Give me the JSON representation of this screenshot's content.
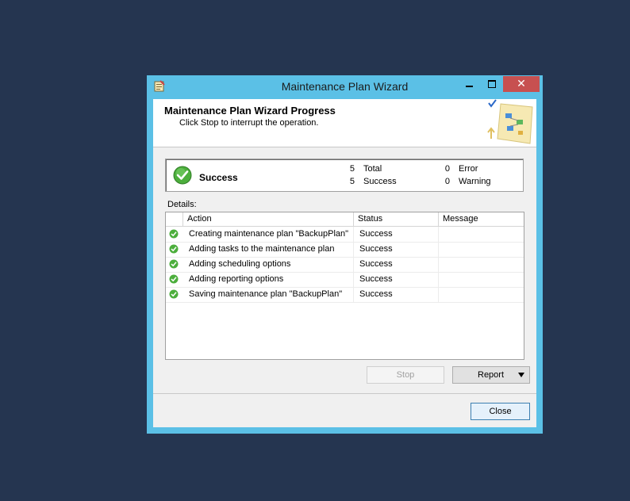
{
  "window": {
    "title": "Maintenance Plan Wizard",
    "icons": {
      "app": "wizard-app-icon",
      "minimize": "minimize-icon",
      "maximize": "maximize-icon",
      "close": "close-icon"
    },
    "close_glyph": "✕"
  },
  "banner": {
    "title": "Maintenance Plan Wizard Progress",
    "subtitle": "Click Stop to interrupt the operation."
  },
  "summary": {
    "status": "Success",
    "total_count": "5",
    "total_label": "Total",
    "success_count": "5",
    "success_label": "Success",
    "error_count": "0",
    "error_label": "Error",
    "warning_count": "0",
    "warning_label": "Warning",
    "icon": "success-check-icon"
  },
  "details": {
    "label": "Details:",
    "columns": [
      "Action",
      "Status",
      "Message"
    ],
    "rows": [
      {
        "action": "Creating maintenance plan \"BackupPlan\"",
        "status": "Success",
        "message": ""
      },
      {
        "action": "Adding tasks to the maintenance plan",
        "status": "Success",
        "message": ""
      },
      {
        "action": "Adding scheduling options",
        "status": "Success",
        "message": ""
      },
      {
        "action": "Adding reporting options",
        "status": "Success",
        "message": ""
      },
      {
        "action": "Saving maintenance plan \"BackupPlan\"",
        "status": "Success",
        "message": ""
      }
    ]
  },
  "buttons": {
    "stop": "Stop",
    "report": "Report",
    "close": "Close"
  },
  "colors": {
    "desktop": "#253550",
    "window_frame": "#5bc0e6",
    "close_button": "#c75050",
    "success_green": "#4cae3c"
  }
}
